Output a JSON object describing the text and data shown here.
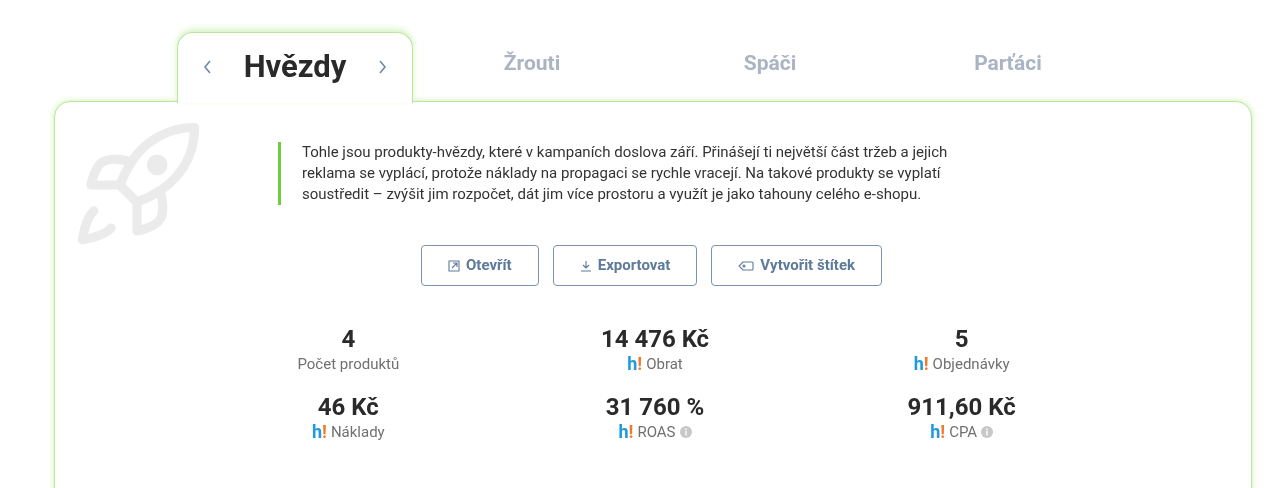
{
  "tabs": [
    {
      "label": "Hvězdy",
      "selected": true
    },
    {
      "label": "Žrouti",
      "selected": false
    },
    {
      "label": "Spáči",
      "selected": false
    },
    {
      "label": "Parťáci",
      "selected": false
    }
  ],
  "description": "Tohle jsou produkty-hvězdy, které v kampaních doslova září. Přinášejí ti největší část tržeb a jejich reklama se vyplácí, protože náklady na propagaci se rychle vracejí. Na takové produkty se vyplatí soustředit – zvýšit jim rozpočet, dát jim více prostoru a využít je jako tahouny celého e-shopu.",
  "actions": [
    {
      "kind": "open",
      "label": "Otevřít"
    },
    {
      "kind": "export",
      "label": "Exportovat"
    },
    {
      "kind": "tag",
      "label": "Vytvořit štítek"
    }
  ],
  "metrics": [
    {
      "value": "4",
      "label": "Počet produktů",
      "info": false
    },
    {
      "value": "14 476 Kč",
      "mark": "h!",
      "label": "Obrat",
      "info": false
    },
    {
      "value": "5",
      "mark": "h!",
      "label": "Objednávky",
      "info": false
    },
    {
      "value": "46 Kč",
      "mark": "h!",
      "label": "Náklady",
      "info": false
    },
    {
      "value": "31 760 %",
      "mark": "h!",
      "label": "ROAS",
      "info": true
    },
    {
      "value": "911,60 Kč",
      "mark": "h!",
      "label": "CPA",
      "info": true
    }
  ]
}
